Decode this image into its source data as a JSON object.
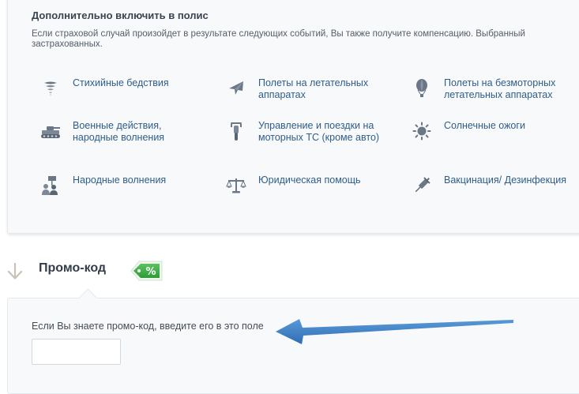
{
  "additional": {
    "title": "Дополнительно включить в полис",
    "description_line1": "Если страховой случай произойдет в результате следующих событий, Вы также получите компенсацию. Выбранный",
    "description_line2": "застрахованных.",
    "options": [
      {
        "label": "Стихийные бедствия",
        "icon": "tornado-icon"
      },
      {
        "label": "Полеты на летательных аппаратах",
        "icon": "airplane-icon"
      },
      {
        "label": "Полеты на безмоторных летательных аппаратах",
        "icon": "hot-air-balloon-icon"
      },
      {
        "label": "Военные действия, народные волнения",
        "icon": "tank-icon"
      },
      {
        "label": "Управление и поездки на моторных ТС (кроме авто)",
        "icon": "motorcycle-icon"
      },
      {
        "label": "Солнечные ожоги",
        "icon": "sun-icon"
      },
      {
        "label": "Народные волнения",
        "icon": "protest-crowd-icon"
      },
      {
        "label": "Юридическая помощь",
        "icon": "scales-icon"
      },
      {
        "label": "Вакцинация/ Дезинфекция",
        "icon": "syringe-icon"
      }
    ]
  },
  "promo": {
    "title": "Промо-код",
    "tag_symbol": "%",
    "hint": "Если Вы знаете промо-код, введите его в это поле",
    "input_value": "",
    "input_placeholder": ""
  },
  "colors": {
    "option_label": "#2f5d8a",
    "tag_green": "#3fae49",
    "annotation_arrow": "#3b7cc4",
    "icon_gray": "#6b7787"
  }
}
